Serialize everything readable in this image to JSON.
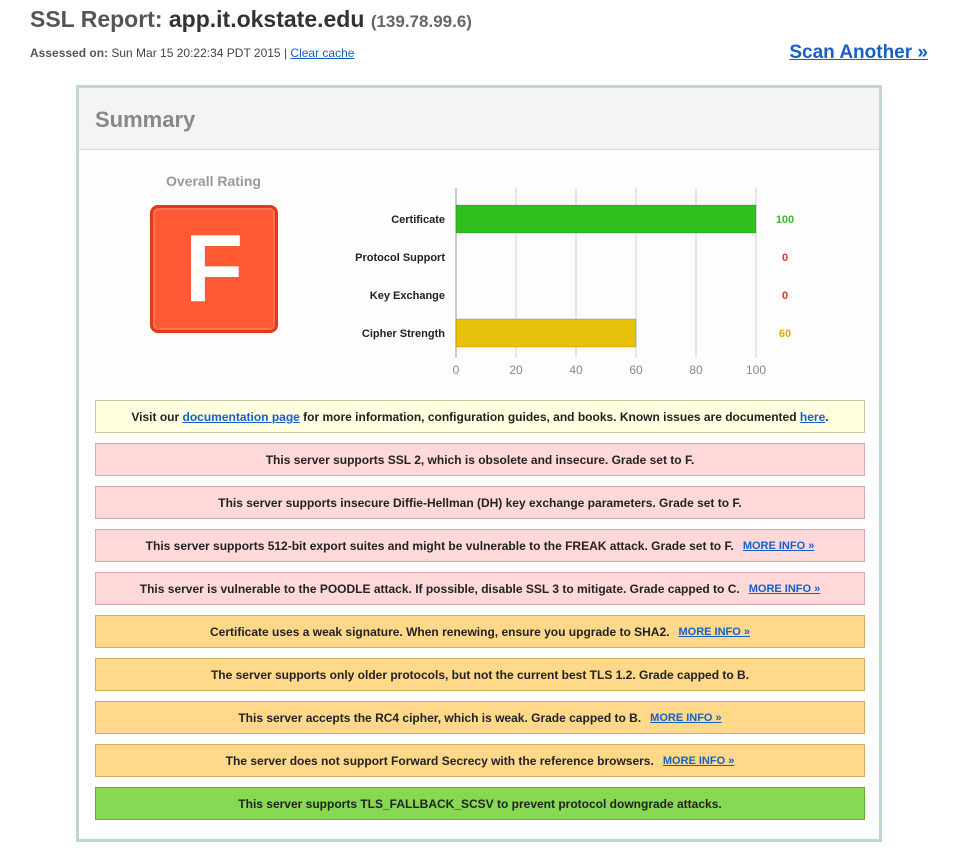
{
  "header": {
    "title_prefix": "SSL Report:",
    "host": "app.it.okstate.edu",
    "ip": "(139.78.99.6)",
    "assessed_label": "Assessed on:",
    "assessed_date": "Sun Mar 15 20:22:34 PDT 2015",
    "separator": "|",
    "clear_cache": "Clear cache",
    "scan_another": "Scan Another »"
  },
  "summary": {
    "title": "Summary",
    "overall_label": "Overall Rating",
    "grade": "F",
    "grade_color": "#ff5a33"
  },
  "chart_data": {
    "type": "bar",
    "orientation": "horizontal",
    "categories": [
      "Certificate",
      "Protocol Support",
      "Key Exchange",
      "Cipher Strength"
    ],
    "values": [
      100,
      0,
      0,
      60
    ],
    "value_labels": [
      "100",
      "0",
      "0",
      "60"
    ],
    "value_colors": [
      "#3cb82e",
      "#d9361c",
      "#d9361c",
      "#e8a417"
    ],
    "bar_colors": [
      "#2fbf1f",
      "#2fbf1f",
      "#2fbf1f",
      "#e8c10a"
    ],
    "xlim": [
      0,
      100
    ],
    "xticks": [
      "0",
      "20",
      "40",
      "60",
      "80",
      "100"
    ],
    "grid": true
  },
  "messages": [
    {
      "type": "info",
      "pre": "Visit our ",
      "link1": "documentation page",
      "mid": " for more information, configuration guides, and books. Known issues are documented ",
      "link2": "here",
      "post": "."
    },
    {
      "type": "error",
      "text": "This server supports SSL 2, which is obsolete and insecure. Grade set to F.",
      "more": ""
    },
    {
      "type": "error",
      "text": "This server supports insecure Diffie-Hellman (DH) key exchange parameters. Grade set to F.",
      "more": ""
    },
    {
      "type": "error",
      "text": "This server supports 512-bit export suites and might be vulnerable to the FREAK attack. Grade set to F.",
      "more": "MORE INFO »"
    },
    {
      "type": "error",
      "text": "This server is vulnerable to the POODLE attack. If possible, disable SSL 3 to mitigate. Grade capped to C.",
      "more": "MORE INFO »"
    },
    {
      "type": "warning",
      "text": "Certificate uses a weak signature. When renewing, ensure you upgrade to SHA2.",
      "more": "MORE INFO »"
    },
    {
      "type": "warning",
      "text": "The server supports only older protocols, but not the current best TLS 1.2. Grade capped to B.",
      "more": ""
    },
    {
      "type": "warning",
      "text": "This server accepts the RC4 cipher, which is weak. Grade capped to B.",
      "more": "MORE INFO »"
    },
    {
      "type": "warning",
      "text": "The server does not support Forward Secrecy with the reference browsers.",
      "more": "MORE INFO »"
    },
    {
      "type": "good",
      "text": "This server supports TLS_FALLBACK_SCSV to prevent protocol downgrade attacks.",
      "more": ""
    }
  ]
}
